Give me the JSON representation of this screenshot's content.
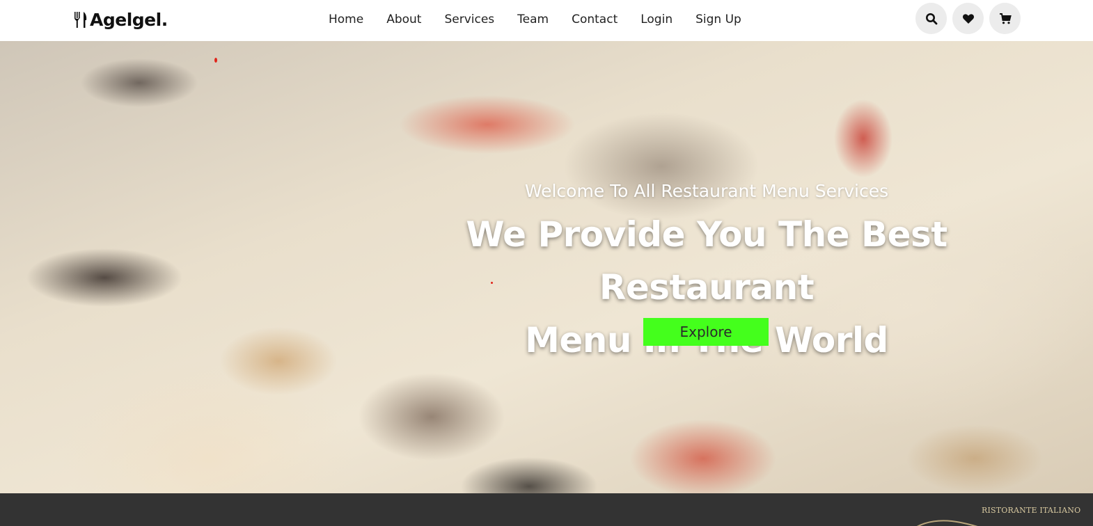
{
  "header": {
    "logo_text": "Agelgel.",
    "nav": [
      {
        "label": "Home"
      },
      {
        "label": "About"
      },
      {
        "label": "Services"
      },
      {
        "label": "Team"
      },
      {
        "label": "Contact"
      },
      {
        "label": "Login"
      },
      {
        "label": "Sign Up"
      }
    ],
    "icons": [
      "search-icon",
      "heart-icon",
      "cart-icon"
    ]
  },
  "hero": {
    "subtitle": "Welcome To All Restaurant Menu Services",
    "title_line1": "We Provide You The Best Restaurant",
    "title_line2": "Menu In The World",
    "cta_label": "Explore",
    "cta_color": "#44ff1c"
  },
  "footer_strip": {
    "brand_text": "RISTORANTE ITALIANO"
  },
  "colors": {
    "header_bg": "#ffffff",
    "icon_button_bg": "#ececec",
    "bottom_bar_bg": "#333333"
  }
}
